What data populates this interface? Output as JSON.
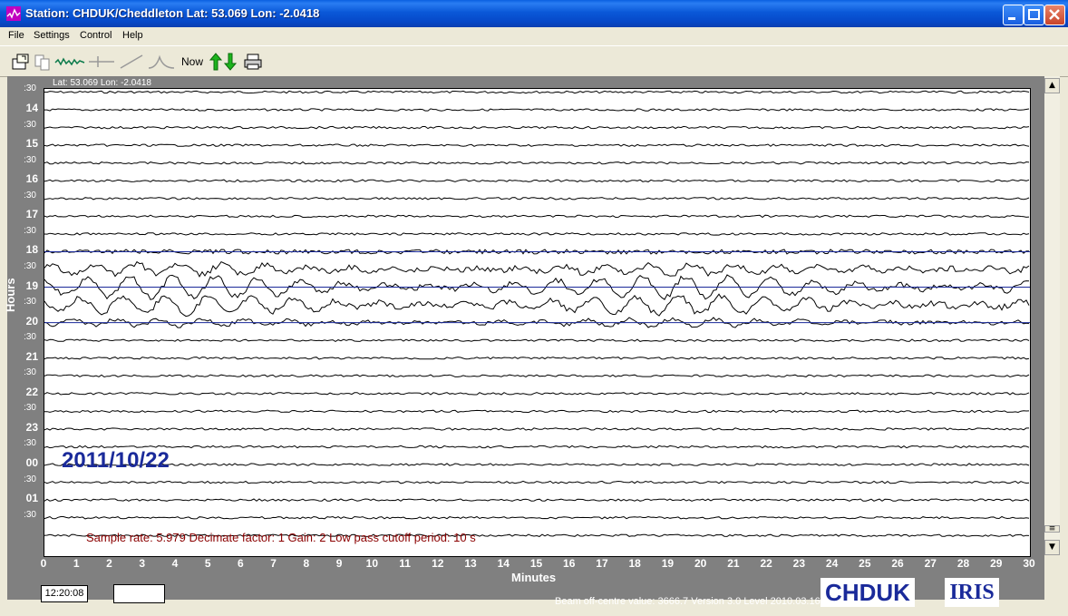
{
  "window": {
    "title": "Station: CHDUK/Cheddleton Lat: 53.069 Lon: -2.0418",
    "minimize": "_",
    "maximize": "□",
    "close": "✕"
  },
  "menu": [
    "File",
    "Settings",
    "Control",
    "Help"
  ],
  "toolbar": {
    "now_label": "Now",
    "icons": [
      "open-file-icon",
      "copy-icon",
      "waveform-icon",
      "filter-icon",
      "slope-icon",
      "pulse-icon",
      "scale-arrows-icon",
      "printer-icon"
    ]
  },
  "plot": {
    "latlon": "Lat: 53.069 Lon: -2.0418",
    "date": "2011/10/22",
    "info": "Sample rate: 5.979  Decimate factor: 1  Gain: 2  Low pass cutoff period: 10 s",
    "y_axis_title": "Hours",
    "x_axis_title": "Minutes",
    "hour_labels": [
      "14",
      "15",
      "16",
      "17",
      "18",
      "19",
      "20",
      "21",
      "22",
      "23",
      "00",
      "01"
    ],
    "half_label": ":30",
    "x_ticks": [
      "0",
      "1",
      "2",
      "3",
      "4",
      "5",
      "6",
      "7",
      "8",
      "9",
      "10",
      "11",
      "12",
      "13",
      "14",
      "15",
      "16",
      "17",
      "18",
      "19",
      "20",
      "21",
      "22",
      "23",
      "24",
      "25",
      "26",
      "27",
      "28",
      "29",
      "30"
    ]
  },
  "status": {
    "time": "12:20:08",
    "beam": "Beam off-centre value: 3666.7  Version 3.0 Level 2010.03.16",
    "logo_station": "CHDUK",
    "logo_org": "IRIS"
  },
  "colors": {
    "trace": "#000000",
    "trace_blue": "#1a2a9a",
    "date": "#1a2a9a",
    "info": "#8b0000"
  }
}
